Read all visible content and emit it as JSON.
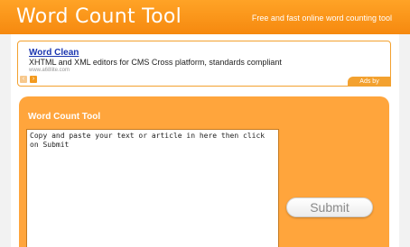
{
  "header": {
    "title": "Word Count Tool",
    "tagline": "Free and fast online word counting tool"
  },
  "ad": {
    "title": "Word Clean",
    "text": "XHTML and XML editors for CMS Cross platform, standards compliant",
    "url": "www.a68lite.com",
    "prev_glyph": "‹",
    "next_glyph": "›",
    "ads_by_prefix": "Ads by",
    "ads_by_brand": "Google"
  },
  "tool": {
    "title": "Word Count Tool",
    "textarea_value": "Copy and paste your text or article in here then click on Submit",
    "submit_label": "Submit"
  },
  "colors": {
    "accent": "#f6890f",
    "panel": "#ffa53c"
  }
}
